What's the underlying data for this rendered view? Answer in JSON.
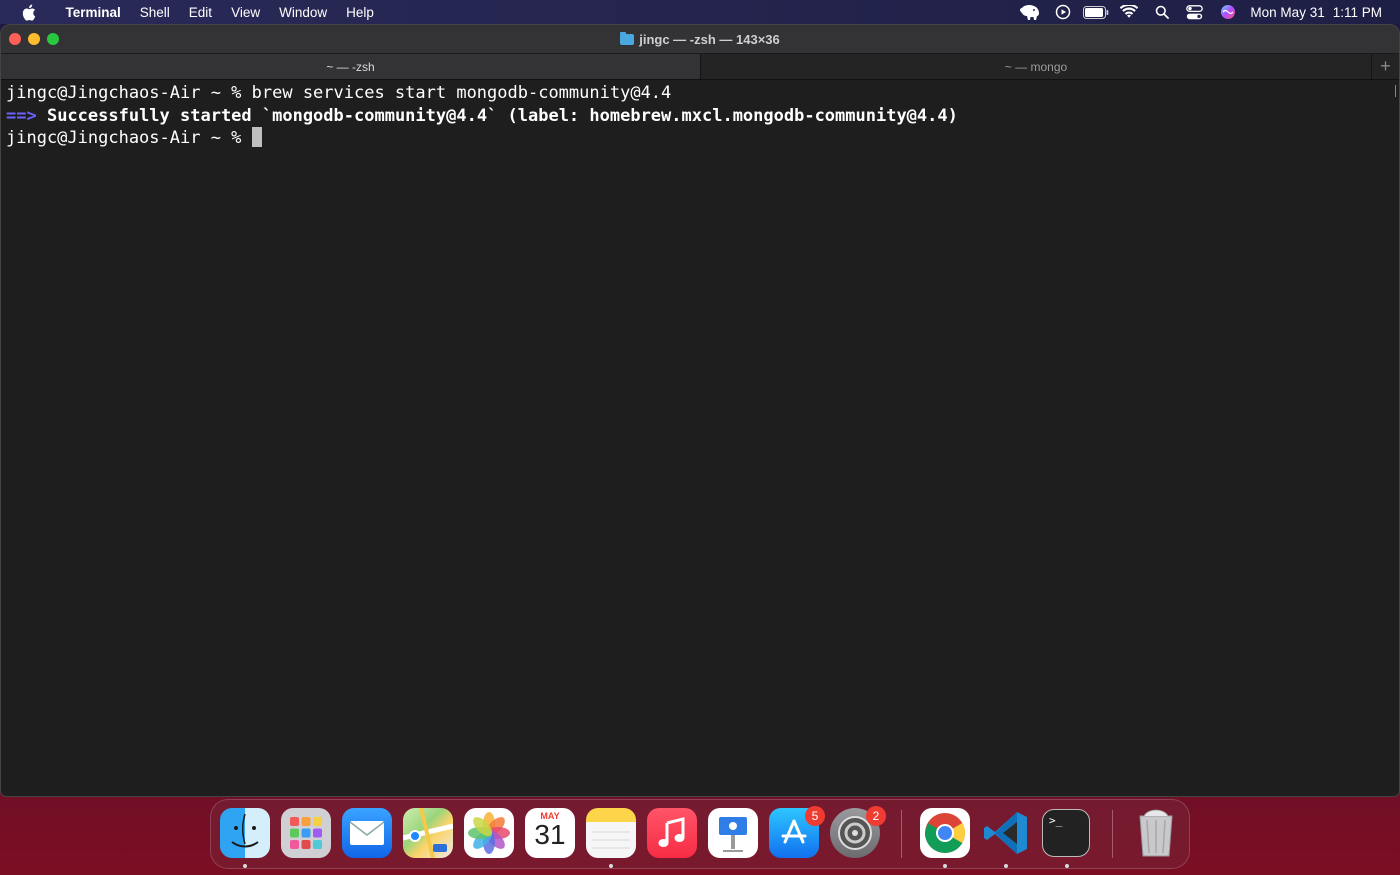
{
  "menubar": {
    "app_name": "Terminal",
    "menus": [
      "Shell",
      "Edit",
      "View",
      "Window",
      "Help"
    ],
    "status_icons": [
      "tableplus-elephant-icon",
      "play-circle-icon",
      "battery-icon",
      "wifi-icon",
      "spotlight-search-icon",
      "control-center-icon",
      "siri-icon"
    ],
    "clock_day": "Mon May 31",
    "clock_time": "1:11 PM"
  },
  "window": {
    "title": "jingc — -zsh — 143×36",
    "tabs": [
      {
        "label": "~ — -zsh",
        "active": true
      },
      {
        "label": "~ — mongo",
        "active": false
      }
    ],
    "add_tab_label": "+"
  },
  "terminal": {
    "line1_prompt": "jingc@Jingchaos-Air ~ % ",
    "line1_command": "brew services start mongodb-community@4.4",
    "line2_arrow": "==>",
    "line2_text": " Successfully started `mongodb-community@4.4` (label: homebrew.mxcl.mongodb-community@4.4)",
    "line3_prompt": "jingc@Jingchaos-Air ~ % "
  },
  "dock": {
    "apps": [
      {
        "name": "Finder",
        "icon": "finder-icon",
        "running": true
      },
      {
        "name": "Launchpad",
        "icon": "launchpad-icon",
        "running": false
      },
      {
        "name": "Mail",
        "icon": "mail-icon",
        "running": false
      },
      {
        "name": "Maps",
        "icon": "maps-icon",
        "running": false
      },
      {
        "name": "Photos",
        "icon": "photos-icon",
        "running": false
      },
      {
        "name": "Calendar",
        "icon": "calendar-icon",
        "running": false
      },
      {
        "name": "Notes",
        "icon": "notes-icon",
        "running": true
      },
      {
        "name": "Music",
        "icon": "music-icon",
        "running": false
      },
      {
        "name": "Keynote",
        "icon": "keynote-icon",
        "running": false
      },
      {
        "name": "App Store",
        "icon": "app-store-icon",
        "running": false,
        "badge": "5"
      },
      {
        "name": "System Preferences",
        "icon": "system-preferences-icon",
        "running": false,
        "badge": "2"
      },
      {
        "name": "Google Chrome",
        "icon": "chrome-icon",
        "running": true
      },
      {
        "name": "Visual Studio Code",
        "icon": "vscode-icon",
        "running": true
      },
      {
        "name": "Terminal",
        "icon": "terminal-icon",
        "running": true
      },
      {
        "name": "Trash",
        "icon": "trash-icon",
        "running": false
      }
    ],
    "calendar_month": "MAY",
    "calendar_day": "31",
    "appstore_badge": "5",
    "prefs_badge": "2",
    "terminal_glyph": ">_"
  }
}
